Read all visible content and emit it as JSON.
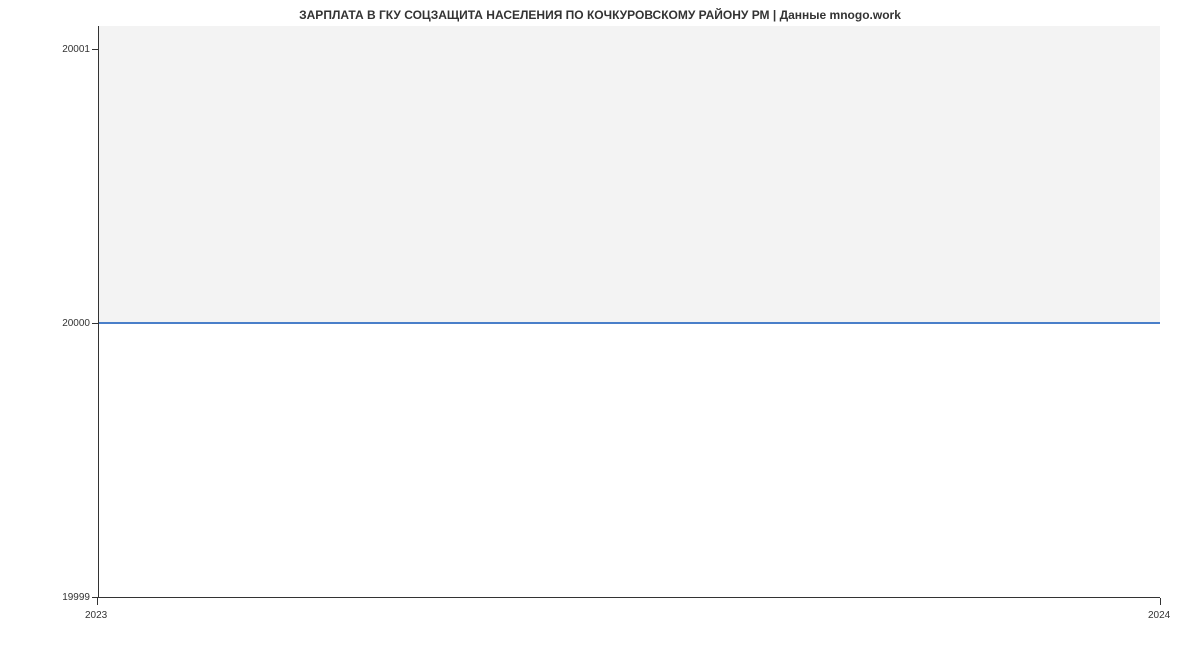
{
  "chart_data": {
    "type": "line",
    "title": "ЗАРПЛАТА В ГКУ СОЦЗАЩИТА НАСЕЛЕНИЯ ПО КОЧКУРОВСКОМУ РАЙОНУ РМ | Данные mnogo.work",
    "x": [
      2023,
      2024
    ],
    "values": [
      20000,
      20000
    ],
    "xlabel": "",
    "ylabel": "",
    "ylim": [
      19999,
      20001
    ],
    "xlim": [
      2023,
      2024
    ],
    "y_ticks": [
      19999,
      20000,
      20001
    ],
    "x_ticks": [
      2023,
      2024
    ],
    "line_color": "#4a7fc9",
    "fill_above_line": "#f3f3f3"
  },
  "labels": {
    "y_tick_0": "19999",
    "y_tick_1": "20000",
    "y_tick_2": "20001",
    "x_tick_0": "2023",
    "x_tick_1": "2024"
  }
}
